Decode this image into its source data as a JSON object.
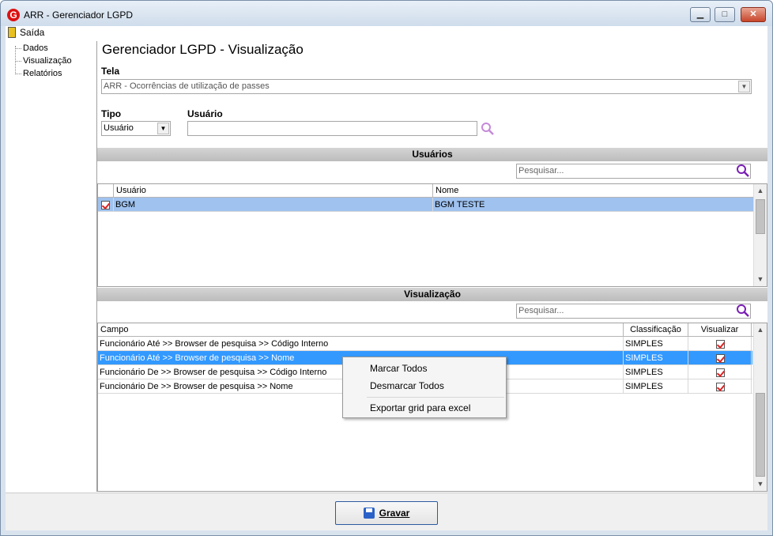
{
  "window": {
    "title": "ARR - Gerenciador LGPD",
    "app_icon_letter": "G",
    "min_glyph": "▁",
    "max_glyph": "□",
    "close_glyph": "✕"
  },
  "menubar": {
    "exit_label": "Saída"
  },
  "sidebar": {
    "items": [
      {
        "label": "Dados"
      },
      {
        "label": "Visualização"
      },
      {
        "label": "Relatórios"
      }
    ]
  },
  "main": {
    "title": "Gerenciador LGPD - Visualização",
    "tela": {
      "label": "Tela",
      "value": "ARR - Ocorrências de utilização de passes"
    },
    "tipo": {
      "label": "Tipo",
      "value": "Usuário"
    },
    "usuario": {
      "label": "Usuário",
      "value": ""
    }
  },
  "users_section": {
    "title": "Usuários",
    "search_placeholder": "Pesquisar...",
    "columns": [
      "Usuário",
      "Nome"
    ],
    "rows": [
      {
        "usuario": "BGM",
        "nome": "BGM TESTE",
        "checked": true
      }
    ]
  },
  "view_section": {
    "title": "Visualização",
    "search_placeholder": "Pesquisar...",
    "columns": [
      "Campo",
      "Classificação",
      "Visualizar"
    ],
    "rows": [
      {
        "campo": "Funcionário Até >> Browser de pesquisa >> Código Interno",
        "classificacao": "SIMPLES",
        "visualizar": true
      },
      {
        "campo": "Funcionário Até >> Browser de pesquisa >> Nome",
        "classificacao": "SIMPLES",
        "visualizar": true
      },
      {
        "campo": "Funcionário De >> Browser de pesquisa >> Código Interno",
        "classificacao": "SIMPLES",
        "visualizar": true
      },
      {
        "campo": "Funcionário De >> Browser de pesquisa >> Nome",
        "classificacao": "SIMPLES",
        "visualizar": true
      }
    ]
  },
  "context_menu": {
    "items": [
      "Marcar Todos",
      "Desmarcar Todos",
      "Exportar grid para excel"
    ]
  },
  "footer": {
    "save_label": "Gravar"
  },
  "colors": {
    "selection": "#3399ff",
    "selection_light": "#9fc2ef",
    "search_icon": "#8a2be2",
    "check": "#dd2222"
  }
}
